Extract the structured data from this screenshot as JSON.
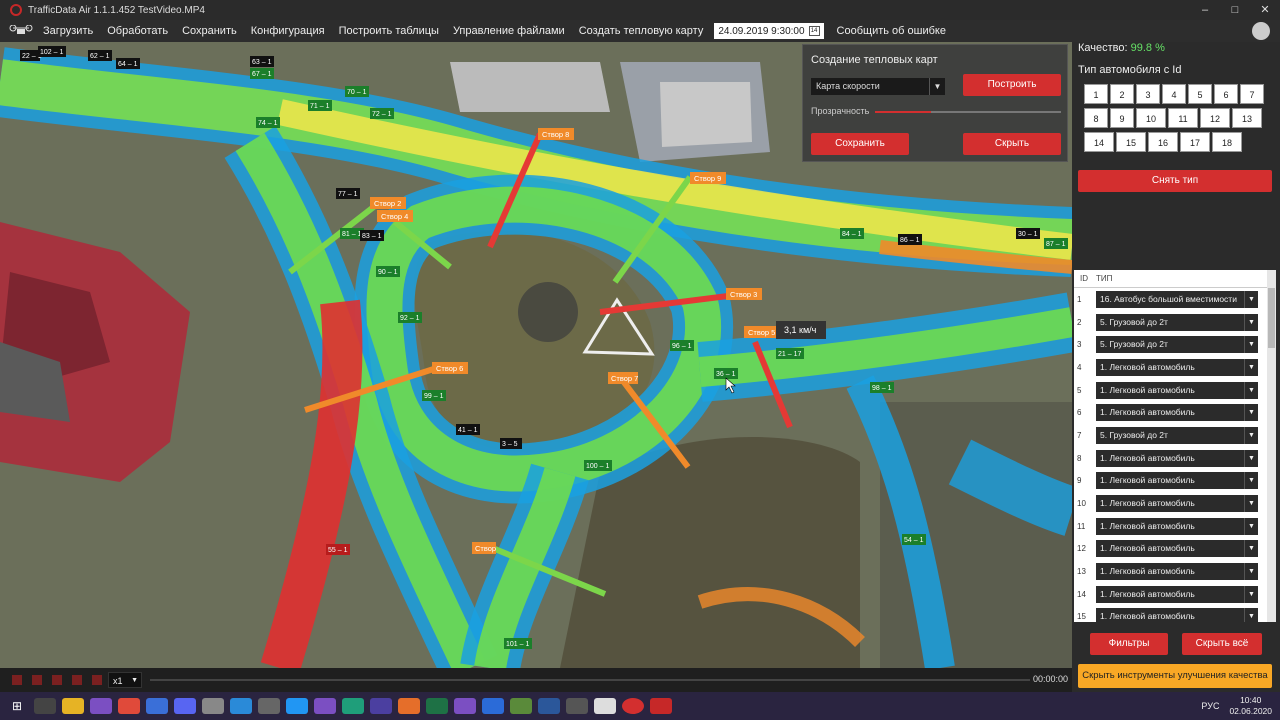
{
  "window": {
    "title": "TrafficData Air 1.1.1.452 TestVideo.MP4"
  },
  "menu": {
    "items": [
      "Загрузить",
      "Обработать",
      "Сохранить",
      "Конфигурация",
      "Построить таблицы",
      "Управление файлами",
      "Создать тепловую карту"
    ],
    "datetime": "24.09.2019 9:30:00",
    "report": "Сообщить об ошибке"
  },
  "heatmap_panel": {
    "title": "Создание тепловых карт",
    "map_type": "Карта скорости",
    "build_label": "Построить",
    "transparency_label": "Прозрачность",
    "transparency_level": 0.3,
    "save_label": "Сохранить",
    "hide_label": "Скрыть"
  },
  "video": {
    "speed_tooltip": "3,1 км/ч",
    "sections": [
      {
        "label": "Створ 8"
      },
      {
        "label": "Створ 9"
      },
      {
        "label": "Створ 2"
      },
      {
        "label": "Створ 4"
      },
      {
        "label": "Створ 3"
      },
      {
        "label": "Створ 5"
      },
      {
        "label": "Створ 6"
      },
      {
        "label": "Створ 7"
      },
      {
        "label": "Створ"
      }
    ],
    "vehicle_tags": [
      "22 – 1",
      "102 – 1",
      "62 – 1",
      "64 – 1",
      "63 – 1",
      "67 – 1",
      "70 – 1",
      "72 – 1",
      "71 – 1",
      "74 – 1",
      "77 – 1",
      "81 – 1",
      "83 – 1",
      "90 – 1",
      "92 – 1",
      "99 – 1",
      "41 – 1",
      "3 – 5",
      "100 – 1",
      "101 – 1",
      "84 – 1",
      "86 – 1",
      "30 – 1",
      "87 – 1",
      "21 – 17",
      "36 – 1",
      "55 – 1",
      "96 – 1",
      "98 – 1",
      "54 – 1"
    ],
    "speed": "x1",
    "time": "00:00:00"
  },
  "right_panel": {
    "quality_label": "Качество:",
    "quality_value": "99.8 %",
    "type_by_id_label": "Тип автомобиля с Id",
    "id_buttons": [
      "1",
      "2",
      "3",
      "4",
      "5",
      "6",
      "7",
      "8",
      "9",
      "10",
      "11",
      "12",
      "13",
      "14",
      "15",
      "16",
      "17",
      "18"
    ],
    "clear_type_label": "Снять тип",
    "table_headers": [
      "ID",
      "ТИП"
    ],
    "rows": [
      {
        "id": "1",
        "type": "16. Автобус большой вместимости"
      },
      {
        "id": "2",
        "type": "5. Грузовой до 2т"
      },
      {
        "id": "3",
        "type": "5. Грузовой до 2т"
      },
      {
        "id": "4",
        "type": "1. Легковой автомобиль"
      },
      {
        "id": "5",
        "type": "1. Легковой автомобиль"
      },
      {
        "id": "6",
        "type": "1. Легковой автомобиль"
      },
      {
        "id": "7",
        "type": "5. Грузовой до 2т"
      },
      {
        "id": "8",
        "type": "1. Легковой автомобиль"
      },
      {
        "id": "9",
        "type": "1. Легковой автомобиль"
      },
      {
        "id": "10",
        "type": "1. Легковой автомобиль"
      },
      {
        "id": "11",
        "type": "1. Легковой автомобиль"
      },
      {
        "id": "12",
        "type": "1. Легковой автомобиль"
      },
      {
        "id": "13",
        "type": "1. Легковой автомобиль"
      },
      {
        "id": "14",
        "type": "1. Легковой автомобиль"
      },
      {
        "id": "15",
        "type": "1. Легковой автомобиль"
      }
    ],
    "filters_label": "Фильтры",
    "hide_all_label": "Скрыть всё",
    "hide_tools_label": "Скрыть инструменты улучшения качества"
  },
  "taskbar": {
    "lang": "РУС",
    "time": "10:40",
    "date": "02.06.2020"
  },
  "colors": {
    "accent_red": "#d32f2f",
    "accent_orange": "#f9a825",
    "quality_green": "#66e066"
  }
}
